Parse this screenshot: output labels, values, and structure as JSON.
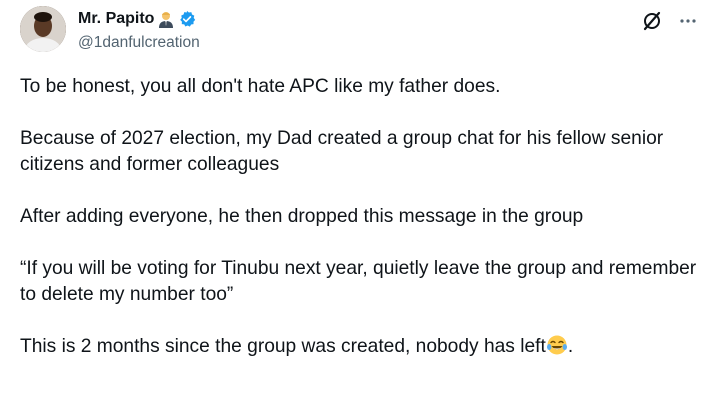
{
  "author": {
    "name": "Mr. Papito",
    "handle": "@1danfulcreation",
    "name_emoji": "person-in-suit-emoji",
    "verified_color": "#1d9bf0"
  },
  "actions": {
    "grok_icon": "grok-icon",
    "more_icon": "more-icon"
  },
  "tweet": {
    "paragraphs": [
      "To be honest, you all don't hate APC like my father does.",
      "Because of 2027 election, my Dad created a group chat for his fellow senior citizens and former colleagues",
      "After adding everyone, he then dropped this message in the group",
      "“If you will be voting for Tinubu next year, quietly leave the group and remember to delete my number too”"
    ],
    "last_paragraph_text": "This is 2 months since the group was created, nobody has left",
    "last_paragraph_emoji": "face-with-tears-of-joy-emoji",
    "last_paragraph_end": "."
  }
}
